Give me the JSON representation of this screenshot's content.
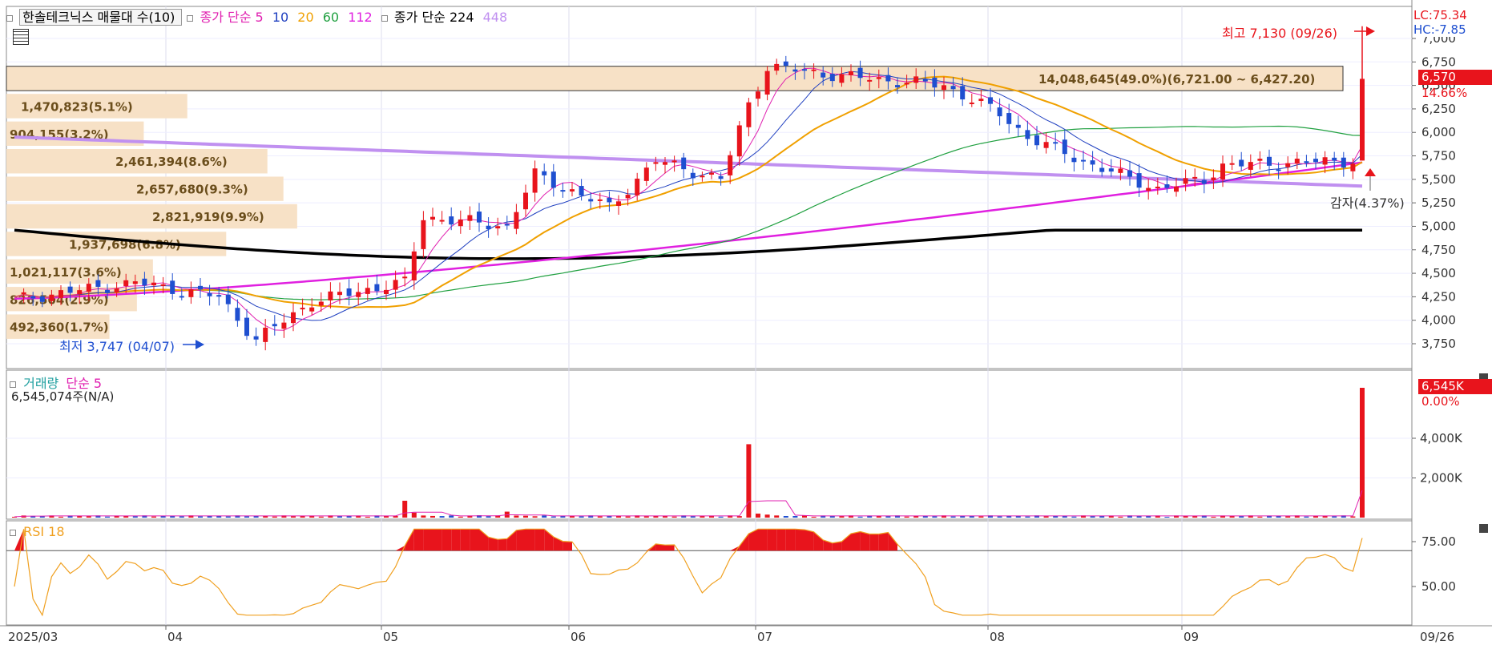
{
  "header": {
    "stock_name": "한솔테크닉스 매물대 수(10)",
    "ma_prefix": "종가 단순 5",
    "ma10": "10",
    "ma20": "20",
    "ma60": "60",
    "ma112": "112",
    "ma2_prefix": "종가 단순 224",
    "ma448": "448"
  },
  "price_axis": {
    "ticks": [
      "7,000",
      "6,750",
      "6,500",
      "6,250",
      "6,000",
      "5,750",
      "5,500",
      "5,250",
      "5,000",
      "4,750",
      "4,500",
      "4,250",
      "4,000",
      "3,750"
    ],
    "lc": "LC:75.34",
    "hc": "HC:-7.85",
    "last_price": "6,570",
    "last_change": "14.66%"
  },
  "annotations": {
    "high": "최고 7,130 (09/26)",
    "low": "최저 3,747 (04/07)",
    "capital_reduction": "감자(4.37%)"
  },
  "volume_profile": [
    {
      "label": "14,048,645(49.0%)(6,721.00 ~ 6,427.20)",
      "low": 6427.2,
      "high": 6721.0,
      "pct": 49.0
    },
    {
      "label": "1,470,823(5.1%)",
      "low": 6133,
      "high": 6427,
      "pct": 5.1
    },
    {
      "label": "904,155(3.2%)",
      "low": 5840,
      "high": 6133,
      "pct": 3.2
    },
    {
      "label": "2,461,394(8.6%)",
      "low": 5546,
      "high": 5840,
      "pct": 8.6
    },
    {
      "label": "2,657,680(9.3%)",
      "low": 5253,
      "high": 5546,
      "pct": 9.3
    },
    {
      "label": "2,821,919(9.9%)",
      "low": 4959,
      "high": 5253,
      "pct": 9.9
    },
    {
      "label": "1,937,698(6.8%)",
      "low": 4666,
      "high": 4959,
      "pct": 6.8
    },
    {
      "label": "1,021,117(3.6%)",
      "low": 4372,
      "high": 4666,
      "pct": 3.6
    },
    {
      "label": "826,504(2.9%)",
      "low": 4079,
      "high": 4372,
      "pct": 2.9
    },
    {
      "label": "492,360(1.7%)",
      "low": 3785,
      "high": 4079,
      "pct": 1.7
    }
  ],
  "volume_panel": {
    "title": "거래량",
    "ma_label": "단순 5",
    "value_text": "6,545,074주(N/A)",
    "ticks": [
      "4,000K",
      "2,000K"
    ],
    "last_value": "6,545K",
    "last_change": "0.00%"
  },
  "rsi_panel": {
    "title": "RSI 18",
    "ticks": [
      "75.00",
      "50.00"
    ]
  },
  "x_axis": {
    "labels": [
      "2025/03",
      "04",
      "05",
      "06",
      "07",
      "08",
      "09",
      "09/26"
    ]
  },
  "colors": {
    "up": "#e8141c",
    "down": "#1f4fd0",
    "ma5": "#e020b0",
    "ma10": "#2040c0",
    "ma20": "#f0a000",
    "ma60": "#20a040",
    "ma112": "#e020e0",
    "ma224": "#000000",
    "ma448": "#c090f0",
    "profile_fill": "#f7e1c6",
    "rsi": "#f0a020"
  },
  "chart_data": {
    "type": "candlestick",
    "ylim": [
      3600,
      7100
    ],
    "dates": [
      "2025/03",
      "04",
      "05",
      "06",
      "07",
      "08",
      "09",
      "09/26"
    ],
    "price_keypoints": [
      {
        "date": "03/04",
        "close": 4250
      },
      {
        "date": "03/20",
        "close": 4400
      },
      {
        "date": "04/01",
        "close": 4250
      },
      {
        "date": "04/07",
        "close": 3790
      },
      {
        "date": "04/15",
        "close": 4200
      },
      {
        "date": "04/25",
        "close": 4350
      },
      {
        "date": "04/30",
        "close": 4400
      },
      {
        "date": "05/02",
        "close": 5100
      },
      {
        "date": "05/15",
        "close": 5000
      },
      {
        "date": "05/20",
        "close": 5550
      },
      {
        "date": "06/02",
        "close": 5200
      },
      {
        "date": "06/10",
        "close": 5700
      },
      {
        "date": "06/20",
        "close": 5500
      },
      {
        "date": "06/24",
        "close": 6300
      },
      {
        "date": "06/26",
        "close": 6700
      },
      {
        "date": "07/10",
        "close": 6600
      },
      {
        "date": "07/25",
        "close": 6500
      },
      {
        "date": "08/01",
        "close": 6200
      },
      {
        "date": "08/05",
        "close": 5950
      },
      {
        "date": "08/15",
        "close": 5650
      },
      {
        "date": "08/25",
        "close": 5400
      },
      {
        "date": "09/02",
        "close": 5500
      },
      {
        "date": "09/05",
        "close": 5650
      },
      {
        "date": "09/25",
        "close": 5700
      },
      {
        "date": "09/26",
        "close": 6570
      }
    ],
    "high": {
      "value": 7130,
      "date": "09/26"
    },
    "low": {
      "value": 3747,
      "date": "04/07"
    },
    "moving_averages": [
      "5",
      "10",
      "20",
      "60",
      "112",
      "224",
      "448"
    ],
    "volume_ylim": [
      0,
      6545000
    ],
    "volume_spikes": [
      {
        "date": "04/30",
        "value": 850000
      },
      {
        "date": "05/15",
        "value": 300000
      },
      {
        "date": "06/24",
        "value": 3700000
      },
      {
        "date": "09/26",
        "value": 6545074
      }
    ],
    "rsi_ylim": [
      30,
      85
    ],
    "rsi_reference": 70
  }
}
